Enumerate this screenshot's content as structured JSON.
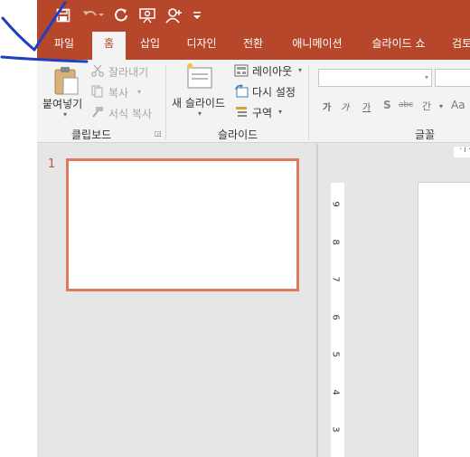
{
  "tabs": [
    "파일",
    "홈",
    "삽입",
    "디자인",
    "전환",
    "애니메이션",
    "슬라이드 쇼",
    "검토"
  ],
  "active_tab": "홈",
  "clipboard": {
    "paste": "붙여넣기",
    "cut": "잘라내기",
    "copy": "복사",
    "format_painter": "서식 복사",
    "group": "클립보드"
  },
  "slides": {
    "new_slide": "새 슬라이드",
    "layout": "레이아웃",
    "reset": "다시 설정",
    "section": "구역",
    "group": "슬라이드"
  },
  "font": {
    "group": "글꼴",
    "buttons": [
      "가",
      "가",
      "가",
      "S",
      "abc",
      "간",
      "Aa"
    ]
  },
  "thumbnail": {
    "number": "1"
  },
  "ruler": {
    "horizontal_label": "16",
    "vertical_numbers": [
      "9",
      "8",
      "7",
      "6",
      "5",
      "4",
      "3"
    ]
  },
  "colors": {
    "accent": "#b7472a",
    "thumb_border": "#e07a5f",
    "pen": "#1f3fbf"
  },
  "icons": [
    "save-icon",
    "undo-icon",
    "redo-icon",
    "presenter-icon",
    "person-icon",
    "customize-icon",
    "checkmark-annotation"
  ]
}
